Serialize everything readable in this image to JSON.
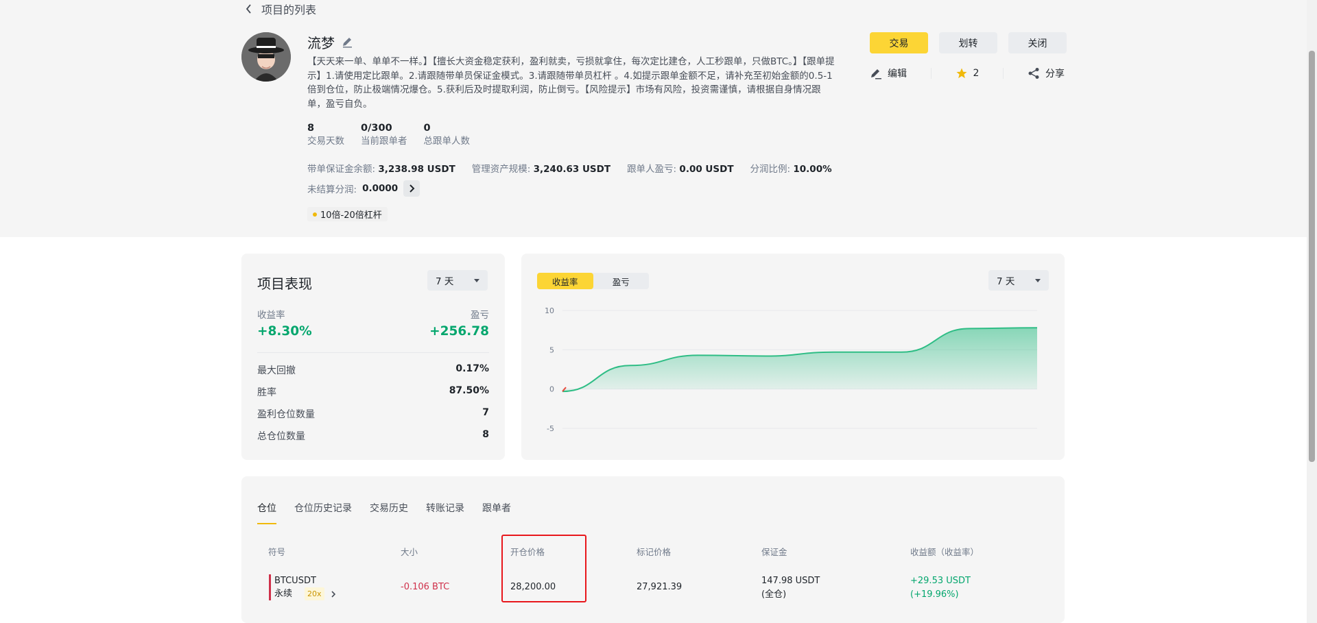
{
  "nav": {
    "back_label": "项目的列表"
  },
  "profile": {
    "name": "流梦",
    "description": "【天天来一单、单单不一样。】【擅长大资金稳定获利，盈利就卖，亏损就拿住，每次定比建仓，人工秒跟单，只做BTC。】【跟单提示】1.请使用定比跟单。2.请跟随带单员保证金模式。3.请跟随带单员杠杆 。4.如提示跟单金额不足，请补充至初始金额的0.5-1倍到仓位，防止极端情况爆仓。5.获利后及时提取利润，防止倒亏。【风险提示】市场有风险，投资需谨慎，请根据自身情况跟单，盈亏自负。",
    "stats": [
      {
        "value": "8",
        "label": "交易天数"
      },
      {
        "value": "0/300",
        "label": "当前跟单者"
      },
      {
        "value": "0",
        "label": "总跟单人数"
      }
    ],
    "metrics": [
      {
        "label": "带单保证金余额:",
        "value": "3,238.98 USDT"
      },
      {
        "label": "管理资产规模:",
        "value": "3,240.63 USDT"
      },
      {
        "label": "跟单人盈亏:",
        "value": "0.00 USDT"
      },
      {
        "label": "分润比例:",
        "value": "10.00%"
      }
    ],
    "unsettled_label": "未结算分润:",
    "unsettled_value": "0.0000",
    "tag": "10倍-20倍杠杆"
  },
  "actions": {
    "trade": "交易",
    "transfer": "划转",
    "close": "关闭",
    "edit": "编辑",
    "favorites": "2",
    "share": "分享"
  },
  "performance": {
    "title": "项目表现",
    "period": "7 天",
    "roi_label": "收益率",
    "roi_value": "+8.30%",
    "pnl_label": "盈亏",
    "pnl_value": "+256.78",
    "rows": [
      {
        "label": "最大回撤",
        "value": "0.17%"
      },
      {
        "label": "胜率",
        "value": "87.50%"
      },
      {
        "label": "盈利仓位数量",
        "value": "7"
      },
      {
        "label": "总仓位数量",
        "value": "8"
      }
    ]
  },
  "chart_panel": {
    "tab_roi": "收益率",
    "tab_pnl": "盈亏",
    "period": "7 天"
  },
  "chart_data": {
    "type": "area",
    "x": [
      0,
      1,
      2,
      3,
      4,
      5,
      6,
      7
    ],
    "series": [
      {
        "values": [
          -0.3,
          3.0,
          4.3,
          4.2,
          4.7,
          4.7,
          7.7,
          7.8
        ]
      }
    ],
    "y_ticks": [
      "10",
      "5",
      "0",
      "-5"
    ],
    "ylim": [
      -5,
      10
    ],
    "colors": {
      "line": "#2ebd85",
      "fill": "#2ebd85",
      "start": "#e8483a"
    }
  },
  "positions": {
    "tabs": [
      "仓位",
      "仓位历史记录",
      "交易历史",
      "转账记录",
      "跟单者"
    ],
    "headers": [
      "符号",
      "大小",
      "开仓价格",
      "标记价格",
      "保证金",
      "收益额（收益率）"
    ],
    "row": {
      "symbol": "BTCUSDT",
      "type": "永续",
      "leverage": "20x",
      "size": "-0.106 BTC",
      "entry_price": "28,200.00",
      "mark_price": "27,921.39",
      "margin": "147.98 USDT",
      "margin_mode": "(全仓)",
      "pnl": "+29.53 USDT",
      "roe": "(+19.96%)"
    }
  }
}
